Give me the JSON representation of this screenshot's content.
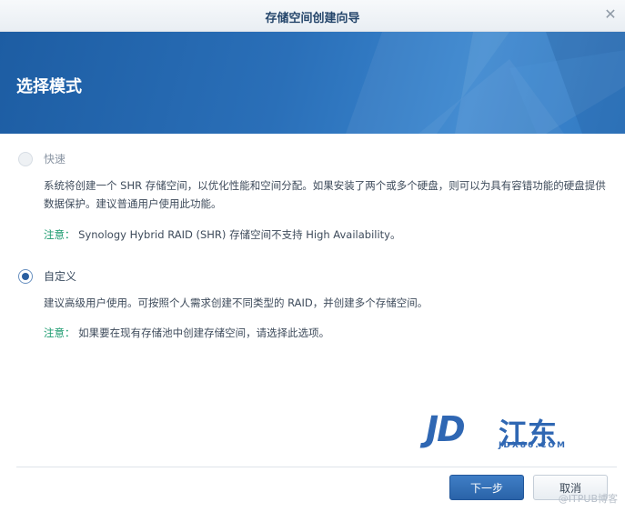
{
  "dialog": {
    "title": "存储空间创建向导",
    "close_icon": "close-icon"
  },
  "banner": {
    "title": "选择模式"
  },
  "options": {
    "quick": {
      "label": "快速",
      "selected": false,
      "enabled": false,
      "description": "系统将创建一个 SHR 存储空间，以优化性能和空间分配。如果安装了两个或多个硬盘，则可以为具有容错功能的硬盘提供数据保护。建议普通用户使用此功能。",
      "note_prefix": "注意：",
      "note_text": " Synology Hybrid RAID (SHR) 存储空间不支持 High Availability。"
    },
    "custom": {
      "label": "自定义",
      "selected": true,
      "enabled": true,
      "description": "建议高级用户使用。可按照个人需求创建不同类型的 RAID，并创建多个存储空间。",
      "note_prefix": "注意：",
      "note_text": " 如果要在现有存储池中创建存储空间，请选择此选项。"
    }
  },
  "watermark": {
    "logo_text": "JD",
    "logo_cn": "江东",
    "logo_url": "JDX86.COM"
  },
  "footer": {
    "next_label": "下一步",
    "cancel_label": "取消",
    "corner_watermark": "@ITPUB博客"
  },
  "colors": {
    "banner": "#2a6fb8",
    "accent": "#2a5fa0",
    "note": "#1a9a6e"
  }
}
